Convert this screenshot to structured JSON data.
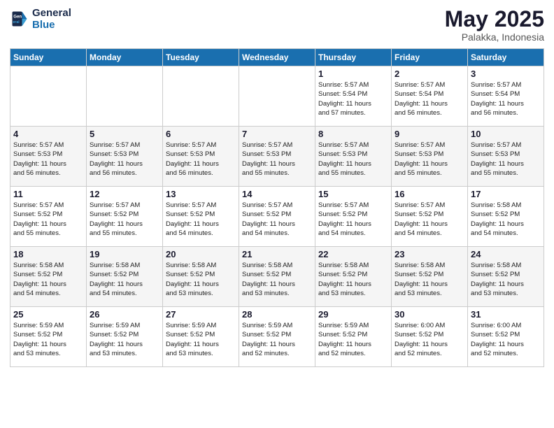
{
  "header": {
    "logo_line1": "General",
    "logo_line2": "Blue",
    "month": "May 2025",
    "location": "Palakka, Indonesia"
  },
  "days_of_week": [
    "Sunday",
    "Monday",
    "Tuesday",
    "Wednesday",
    "Thursday",
    "Friday",
    "Saturday"
  ],
  "weeks": [
    [
      {
        "day": "",
        "info": ""
      },
      {
        "day": "",
        "info": ""
      },
      {
        "day": "",
        "info": ""
      },
      {
        "day": "",
        "info": ""
      },
      {
        "day": "1",
        "info": "Sunrise: 5:57 AM\nSunset: 5:54 PM\nDaylight: 11 hours\nand 57 minutes."
      },
      {
        "day": "2",
        "info": "Sunrise: 5:57 AM\nSunset: 5:54 PM\nDaylight: 11 hours\nand 56 minutes."
      },
      {
        "day": "3",
        "info": "Sunrise: 5:57 AM\nSunset: 5:54 PM\nDaylight: 11 hours\nand 56 minutes."
      }
    ],
    [
      {
        "day": "4",
        "info": "Sunrise: 5:57 AM\nSunset: 5:53 PM\nDaylight: 11 hours\nand 56 minutes."
      },
      {
        "day": "5",
        "info": "Sunrise: 5:57 AM\nSunset: 5:53 PM\nDaylight: 11 hours\nand 56 minutes."
      },
      {
        "day": "6",
        "info": "Sunrise: 5:57 AM\nSunset: 5:53 PM\nDaylight: 11 hours\nand 56 minutes."
      },
      {
        "day": "7",
        "info": "Sunrise: 5:57 AM\nSunset: 5:53 PM\nDaylight: 11 hours\nand 55 minutes."
      },
      {
        "day": "8",
        "info": "Sunrise: 5:57 AM\nSunset: 5:53 PM\nDaylight: 11 hours\nand 55 minutes."
      },
      {
        "day": "9",
        "info": "Sunrise: 5:57 AM\nSunset: 5:53 PM\nDaylight: 11 hours\nand 55 minutes."
      },
      {
        "day": "10",
        "info": "Sunrise: 5:57 AM\nSunset: 5:53 PM\nDaylight: 11 hours\nand 55 minutes."
      }
    ],
    [
      {
        "day": "11",
        "info": "Sunrise: 5:57 AM\nSunset: 5:52 PM\nDaylight: 11 hours\nand 55 minutes."
      },
      {
        "day": "12",
        "info": "Sunrise: 5:57 AM\nSunset: 5:52 PM\nDaylight: 11 hours\nand 55 minutes."
      },
      {
        "day": "13",
        "info": "Sunrise: 5:57 AM\nSunset: 5:52 PM\nDaylight: 11 hours\nand 54 minutes."
      },
      {
        "day": "14",
        "info": "Sunrise: 5:57 AM\nSunset: 5:52 PM\nDaylight: 11 hours\nand 54 minutes."
      },
      {
        "day": "15",
        "info": "Sunrise: 5:57 AM\nSunset: 5:52 PM\nDaylight: 11 hours\nand 54 minutes."
      },
      {
        "day": "16",
        "info": "Sunrise: 5:57 AM\nSunset: 5:52 PM\nDaylight: 11 hours\nand 54 minutes."
      },
      {
        "day": "17",
        "info": "Sunrise: 5:58 AM\nSunset: 5:52 PM\nDaylight: 11 hours\nand 54 minutes."
      }
    ],
    [
      {
        "day": "18",
        "info": "Sunrise: 5:58 AM\nSunset: 5:52 PM\nDaylight: 11 hours\nand 54 minutes."
      },
      {
        "day": "19",
        "info": "Sunrise: 5:58 AM\nSunset: 5:52 PM\nDaylight: 11 hours\nand 54 minutes."
      },
      {
        "day": "20",
        "info": "Sunrise: 5:58 AM\nSunset: 5:52 PM\nDaylight: 11 hours\nand 53 minutes."
      },
      {
        "day": "21",
        "info": "Sunrise: 5:58 AM\nSunset: 5:52 PM\nDaylight: 11 hours\nand 53 minutes."
      },
      {
        "day": "22",
        "info": "Sunrise: 5:58 AM\nSunset: 5:52 PM\nDaylight: 11 hours\nand 53 minutes."
      },
      {
        "day": "23",
        "info": "Sunrise: 5:58 AM\nSunset: 5:52 PM\nDaylight: 11 hours\nand 53 minutes."
      },
      {
        "day": "24",
        "info": "Sunrise: 5:58 AM\nSunset: 5:52 PM\nDaylight: 11 hours\nand 53 minutes."
      }
    ],
    [
      {
        "day": "25",
        "info": "Sunrise: 5:59 AM\nSunset: 5:52 PM\nDaylight: 11 hours\nand 53 minutes."
      },
      {
        "day": "26",
        "info": "Sunrise: 5:59 AM\nSunset: 5:52 PM\nDaylight: 11 hours\nand 53 minutes."
      },
      {
        "day": "27",
        "info": "Sunrise: 5:59 AM\nSunset: 5:52 PM\nDaylight: 11 hours\nand 53 minutes."
      },
      {
        "day": "28",
        "info": "Sunrise: 5:59 AM\nSunset: 5:52 PM\nDaylight: 11 hours\nand 52 minutes."
      },
      {
        "day": "29",
        "info": "Sunrise: 5:59 AM\nSunset: 5:52 PM\nDaylight: 11 hours\nand 52 minutes."
      },
      {
        "day": "30",
        "info": "Sunrise: 6:00 AM\nSunset: 5:52 PM\nDaylight: 11 hours\nand 52 minutes."
      },
      {
        "day": "31",
        "info": "Sunrise: 6:00 AM\nSunset: 5:52 PM\nDaylight: 11 hours\nand 52 minutes."
      }
    ]
  ]
}
